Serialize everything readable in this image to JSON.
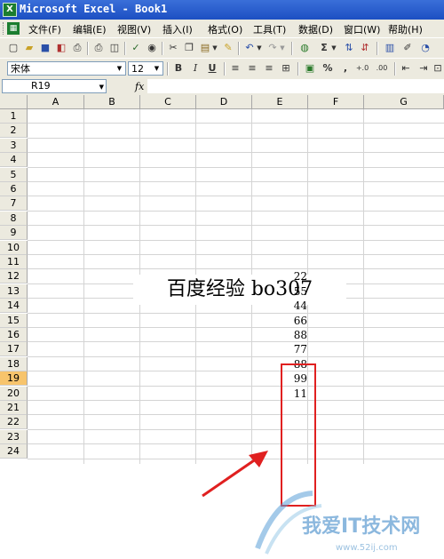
{
  "window": {
    "app_icon": "excel-icon",
    "title": "Microsoft Excel - Book1"
  },
  "menu": {
    "items": [
      "文件(F)",
      "编辑(E)",
      "视图(V)",
      "插入(I)",
      "格式(O)",
      "工具(T)",
      "数据(D)",
      "窗口(W)",
      "帮助(H)"
    ]
  },
  "toolbar_standard": {
    "icons": [
      "new-icon",
      "open-icon",
      "save-icon",
      "permission-icon",
      "print-icon",
      "print-preview-icon",
      "spelling-icon",
      "research-icon",
      "cut-icon",
      "copy-icon",
      "paste-icon",
      "format-painter-icon",
      "undo-icon",
      "redo-icon",
      "hyperlink-icon",
      "autosum-icon",
      "sort-ascending-icon",
      "sort-descending-icon",
      "chart-wizard-icon",
      "drawing-icon"
    ],
    "autosum_glyph": "Σ"
  },
  "toolbar_format": {
    "font_name": "宋体",
    "font_size": "12",
    "bold": "B",
    "italic": "I",
    "underline": "U",
    "percent": "%",
    "comma": ",",
    "increase_decimal": "+.0",
    "decrease_decimal": ".00"
  },
  "formula_bar": {
    "name_box": "R19",
    "fx_label": "fx",
    "formula": ""
  },
  "sheet": {
    "columns": [
      "A",
      "B",
      "C",
      "D",
      "E",
      "F",
      "G"
    ],
    "rows": [
      "1",
      "2",
      "3",
      "4",
      "5",
      "6",
      "7",
      "8",
      "9",
      "10",
      "11",
      "12",
      "13",
      "14",
      "15",
      "16",
      "17",
      "18",
      "19",
      "20",
      "21",
      "22",
      "23",
      "24"
    ],
    "active_row": "19",
    "banner_text": "百度经验  bo307",
    "column_e_values": [
      "22",
      "55",
      "44",
      "66",
      "88",
      "77",
      "88",
      "99",
      "11"
    ]
  },
  "colors": {
    "annotation_red": "#e02020",
    "toolbar_bg": "#eceadf",
    "titlebar_blue": "#1c4fc2"
  },
  "watermark": {
    "text": "我爱IT技术网",
    "url": "www.52ij.com"
  }
}
